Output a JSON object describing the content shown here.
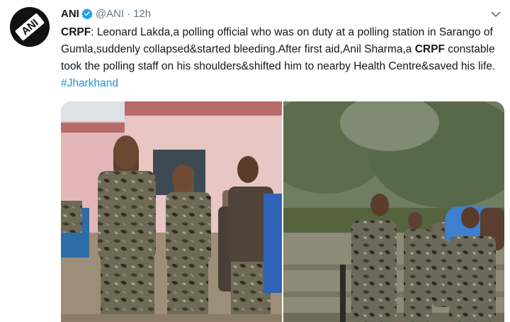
{
  "account": {
    "name": "ANI",
    "handle": "@ANI",
    "separator": "·",
    "time": "12h",
    "avatar_text": "ANI"
  },
  "icons": {
    "verified": "verified-badge-icon",
    "menu": "chevron-down-icon"
  },
  "colors": {
    "link": "#1b95e0",
    "verified": "#1da1f2",
    "muted": "#657786"
  },
  "tweet": {
    "seg1": "CRPF",
    "seg2": ": Leonard Lakda,a polling official who was on duty at a polling station in Sarango of Gumla,suddenly collapsed&started bleeding.After first aid,Anil Sharma,a ",
    "seg3": "CRPF",
    "seg4": " constable took the polling staff on his shoulders&shifted him to nearby Health Centre&saved his life. ",
    "hashtag": "#Jharkhand"
  }
}
